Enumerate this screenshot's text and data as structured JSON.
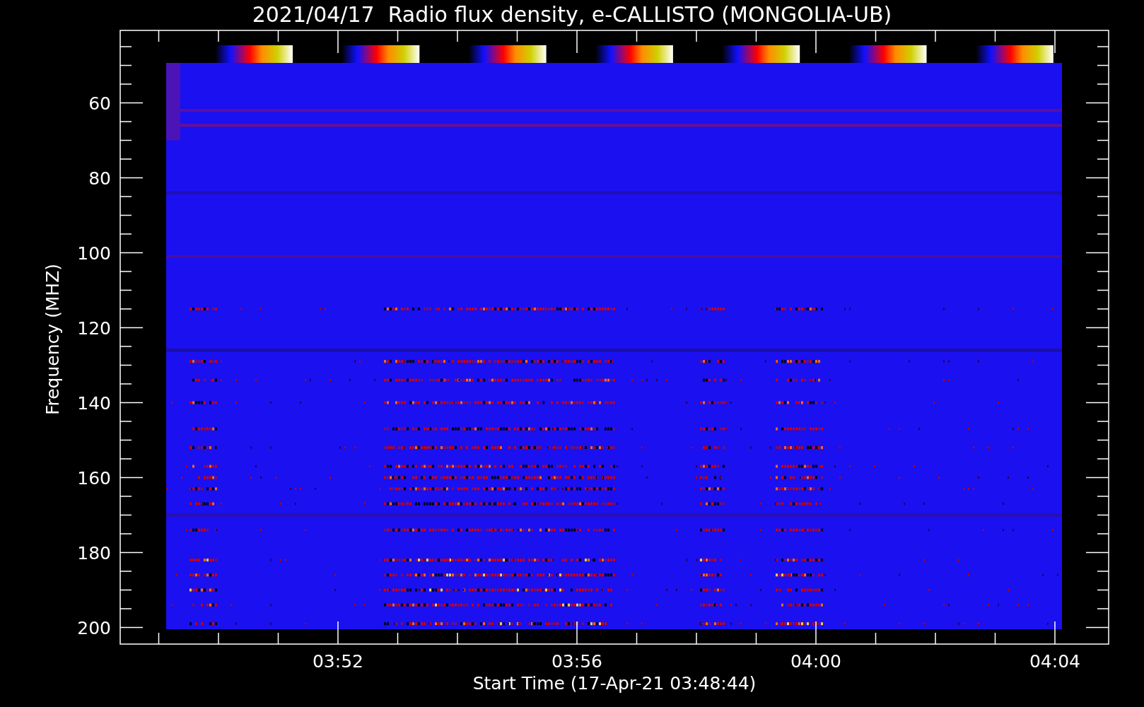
{
  "plot": {
    "title": "2021/04/17  Radio flux density, e-CALLISTO (MONGOLIA-UB)",
    "ylabel": "Frequency (MHZ)",
    "xlabel": "Start Time (17-Apr-21 03:48:44)",
    "y_tick_labels": [
      "60",
      "80",
      "100",
      "120",
      "140",
      "160",
      "180",
      "200"
    ],
    "x_tick_labels": [
      "03:52",
      "03:56",
      "04:00",
      "04:04"
    ]
  }
}
